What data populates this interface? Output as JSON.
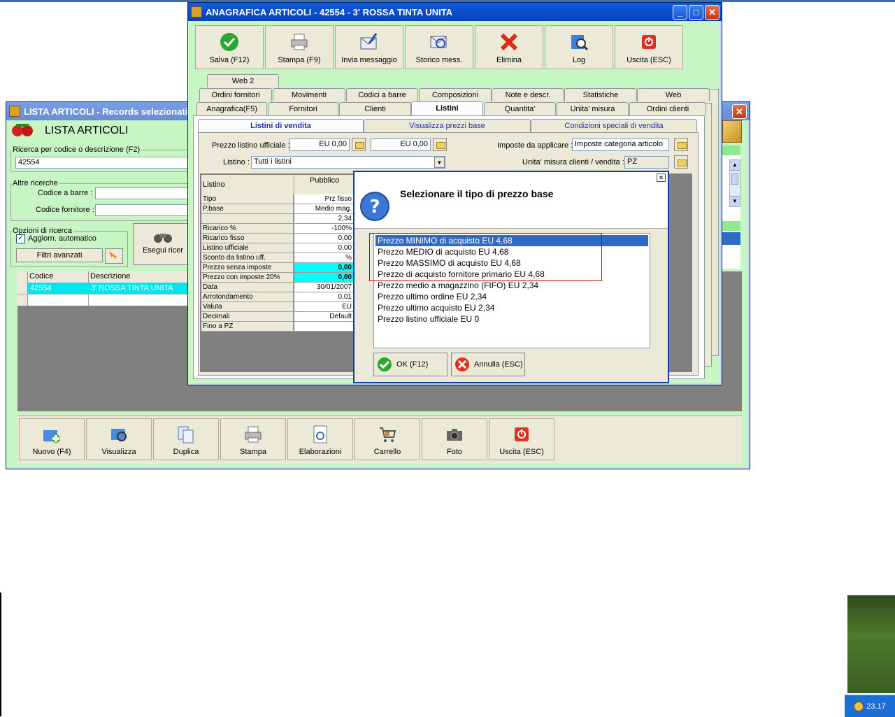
{
  "lista": {
    "title": "LISTA ARTICOLI - Records selezionati :",
    "header": "LISTA ARTICOLI",
    "search_legend": "Ricerca per codice o descrizione (F2)",
    "search_value": "42554",
    "altre_legend": "Altre ricerche",
    "codice_barre_label": "Codice a barre :",
    "codice_fornitore_label": "Codice fornitore :",
    "opzioni_legend": "Opzioni di ricerca",
    "aggiorn_label": "Aggiorn. automatico",
    "filtri_label": "Filtri avanzati",
    "esegui_label": "Esegui ricer",
    "columns": [
      "Codice",
      "Descrizione"
    ],
    "rows": [
      {
        "codice": "42554",
        "descrizione": "3' ROSSA TINTA UNITA"
      }
    ],
    "buttons": [
      "Nuovo (F4)",
      "Visualizza",
      "Duplica",
      "Stampa",
      "Elaborazioni",
      "Carrello",
      "Foto",
      "Uscita (ESC)"
    ]
  },
  "anagrafica": {
    "title": "ANAGRAFICA ARTICOLI - 42554 - 3' ROSSA TINTA UNITA",
    "toolbar": [
      "Salva (F12)",
      "Stampa (F9)",
      "Invia messaggio",
      "Storico mess.",
      "Elimina",
      "Log",
      "Uscita (ESC)"
    ],
    "tabs_row1": [
      "Web 2"
    ],
    "tabs_row2": [
      "Ordini fornitori",
      "Movimenti",
      "Codici a barre",
      "Composizioni",
      "Note e descr.",
      "Statistiche",
      "Web"
    ],
    "tabs_row3": [
      "Anagrafica(F5)",
      "Fornitori",
      "Clienti",
      "Listini",
      "Quantita'",
      "Unita' misura",
      "Ordini clienti"
    ],
    "subtabs": [
      "Listini di vendita",
      "Visualizza prezzi base",
      "Condizioni speciali di vendita"
    ],
    "prezzo_label": "Prezzo listino ufficiale :",
    "prezzo_val1": "EU 0,00",
    "prezzo_val2": "EU 0,00",
    "imposte_label": "Imposte da applicare :",
    "imposte_value": "Imposte categoria articolo",
    "listino_label": "Listino :",
    "listino_value": "Tutti i listini",
    "unita_label": "Unita' misura clienti / vendita :",
    "unita_value": "PZ",
    "grid_header": {
      "left": "Listino",
      "right": "Pubblico"
    },
    "grid_rows": [
      {
        "label": "Tipo",
        "value": "Prz fisso"
      },
      {
        "label": "P.base",
        "value": "Medio mag."
      },
      {
        "label": "",
        "value": "2,34"
      },
      {
        "label": "Ricarico %",
        "value": "-100%"
      },
      {
        "label": "Ricarico fisso",
        "value": "0,00"
      },
      {
        "label": "Listino ufficiale",
        "value": "0,00"
      },
      {
        "label": "Sconto da listino uff.",
        "value": "%"
      },
      {
        "label": "Prezzo senza imposte",
        "value": "0,00"
      },
      {
        "label": "Prezzo con imposte 20%",
        "value": "0,00"
      },
      {
        "label": "Data",
        "value": "30/01/2007"
      },
      {
        "label": "Arrotondamento",
        "value": "0,01"
      },
      {
        "label": "Valuta",
        "value": "EU"
      },
      {
        "label": "Decimali",
        "value": "Default"
      },
      {
        "label": "Fino a PZ",
        "value": ""
      }
    ]
  },
  "dialog": {
    "title": "Selezionare il tipo di prezzo base",
    "options": [
      "Prezzo MINIMO di acquisto EU 4,68",
      "Prezzo MEDIO di acquisto EU 4,68",
      "Prezzo MASSIMO di acquisto EU 4,68",
      "Prezzo di acquisto fornitore primario EU 4,68",
      "Prezzo medio a magazzino (FIFO) EU 2,34",
      "Prezzo ultimo ordine EU 2,34",
      "Prezzo ultimo acquisto EU 2,34",
      "Prezzo listino ufficiale EU 0"
    ],
    "ok_label": "OK (F12)",
    "cancel_label": "Annulla (ESC)"
  },
  "taskbar": {
    "clock": "23.17"
  },
  "colors": {
    "title_active": "#0a4fd0",
    "green_bg": "#c8f5c4",
    "selection": "#316ac5",
    "highlight_cyan": "#00ffff",
    "annotation_red": "#cc0000"
  }
}
